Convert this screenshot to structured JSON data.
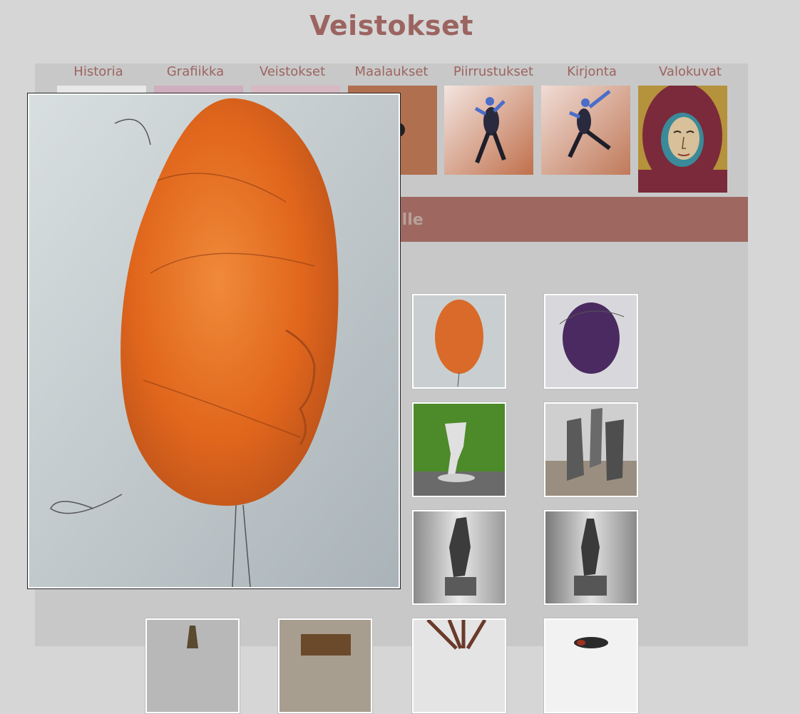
{
  "page": {
    "title": "Veistokset"
  },
  "nav": {
    "items": [
      {
        "label": "Historia"
      },
      {
        "label": "Grafiikka"
      },
      {
        "label": "Veistokset"
      },
      {
        "label": "Maalaukset"
      },
      {
        "label": "Piirrustukset"
      },
      {
        "label": "Kirjonta"
      },
      {
        "label": "Valokuvat"
      }
    ]
  },
  "banner": {
    "visible_text": "ulle"
  },
  "gallery": {
    "thumbnails": [
      {
        "icon": "orange-mask-sculpture"
      },
      {
        "icon": "purple-mask-sculpture"
      },
      {
        "icon": "stone-sculpture-on-grass"
      },
      {
        "icon": "pair-of-stone-sculptures"
      },
      {
        "icon": "tall-stone-sculpture"
      },
      {
        "icon": "tall-stone-sculpture-2"
      },
      {
        "icon": "small-bronze-sculpture"
      },
      {
        "icon": "wooden-sculpture"
      },
      {
        "icon": "spiky-sculpture"
      },
      {
        "icon": "bird-sculpture"
      }
    ]
  },
  "lightbox": {
    "icon": "orange-mask-sculpture-large"
  },
  "colors": {
    "background": "#d6d6d6",
    "panel": "#c8c8c8",
    "accent": "#9c6460",
    "banner": "#9e6860"
  }
}
